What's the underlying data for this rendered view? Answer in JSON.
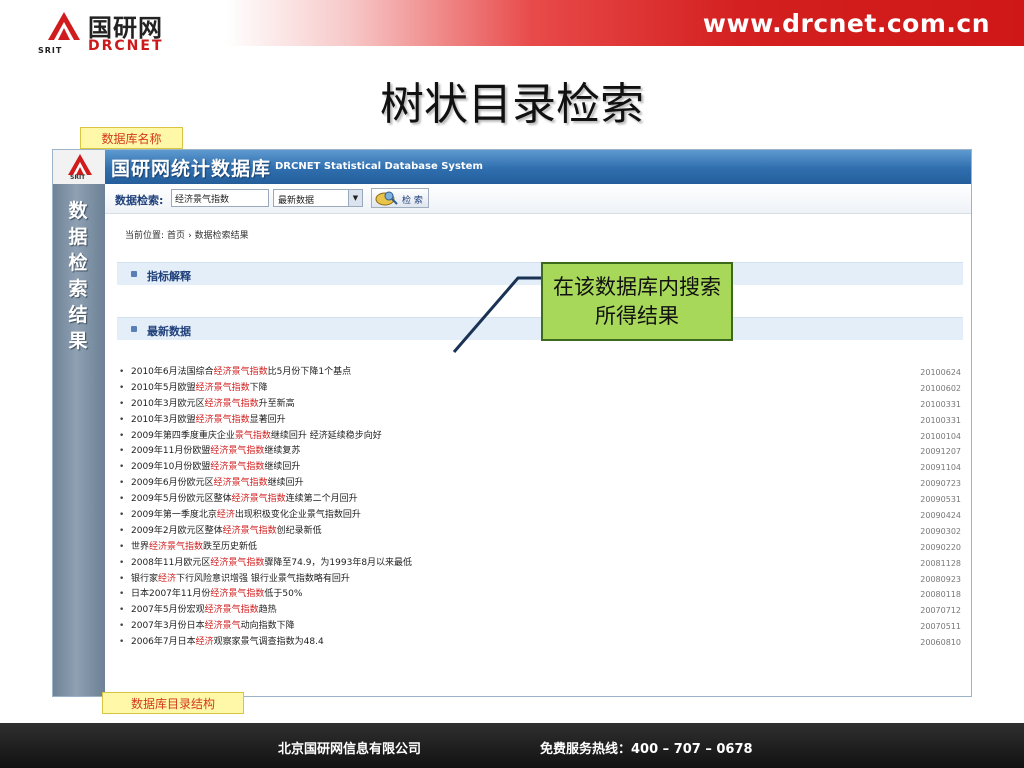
{
  "brand": {
    "logo_cn": "国研网",
    "logo_en": "DRCNET",
    "logo_srit": "SRIT",
    "site_url": "www.drcnet.com.cn"
  },
  "slide": {
    "title": "树状目录检索",
    "tag_top": "数据库名称",
    "tag_bottom": "数据库目录结构",
    "callout": "在该数据库内搜索所得结果"
  },
  "app": {
    "title": "国研网统计数据库",
    "subtitle": "DRCNET Statistical Database System",
    "srit": "SRIT",
    "side_tab": "数据检索结果",
    "search": {
      "label": "数据检索:",
      "value": "经济景气指数",
      "select_value": "最新数据",
      "button_label": "检 索"
    },
    "breadcrumb": {
      "prefix": "当前位置:",
      "home": "首页",
      "separator": "›",
      "current": "数据检索结果"
    },
    "sections": {
      "indicator": "指标解释",
      "latest": "最新数据"
    },
    "results": [
      {
        "pre": "2010年6月法国综合",
        "hl": "经济景气指数",
        "post": "比5月份下降1个基点",
        "date": "20100624"
      },
      {
        "pre": "2010年5月欧盟",
        "hl": "经济景气指数",
        "post": "下降",
        "date": "20100602"
      },
      {
        "pre": "2010年3月欧元区",
        "hl": "经济景气指数",
        "post": "升至新高",
        "date": "20100331"
      },
      {
        "pre": "2010年3月欧盟",
        "hl": "经济景气指数",
        "post": "显著回升",
        "date": "20100331"
      },
      {
        "pre": "2009年第四季度重庆企业",
        "hl": "景气指数",
        "post": "继续回升 经济延续稳步向好",
        "date": "20100104"
      },
      {
        "pre": "2009年11月份欧盟",
        "hl": "经济景气指数",
        "post": "继续复苏",
        "date": "20091207"
      },
      {
        "pre": "2009年10月份欧盟",
        "hl": "经济景气指数",
        "post": "继续回升",
        "date": "20091104"
      },
      {
        "pre": "2009年6月份欧元区",
        "hl": "经济景气指数",
        "post": "继续回升",
        "date": "20090723"
      },
      {
        "pre": "2009年5月份欧元区整体",
        "hl": "经济景气指数",
        "post": "连续第二个月回升",
        "date": "20090531"
      },
      {
        "pre": "2009年第一季度北京",
        "hl": "经济",
        "post": "出现积极变化企业景气指数回升",
        "date": "20090424"
      },
      {
        "pre": "2009年2月欧元区整体",
        "hl": "经济景气指数",
        "post": "创纪录新低",
        "date": "20090302"
      },
      {
        "pre": "世界",
        "hl": "经济景气指数",
        "post": "跌至历史新低",
        "date": "20090220"
      },
      {
        "pre": "2008年11月欧元区",
        "hl": "经济景气指数",
        "post": "骤降至74.9，为1993年8月以来最低",
        "date": "20081128"
      },
      {
        "pre": "银行家",
        "hl": "经济",
        "post": "下行风险意识增强 银行业景气指数略有回升",
        "date": "20080923"
      },
      {
        "pre": "日本2007年11月份",
        "hl": "经济景气指数",
        "post": "低于50%",
        "date": "20080118"
      },
      {
        "pre": "2007年5月份宏观",
        "hl": "经济景气指数",
        "post": "趋热",
        "date": "20070712"
      },
      {
        "pre": "2007年3月份日本",
        "hl": "经济景气",
        "post": "动向指数下降",
        "date": "20070511"
      },
      {
        "pre": "2006年7月日本",
        "hl": "经济",
        "post": "观察家景气调查指数为48.4",
        "date": "20060810"
      }
    ]
  },
  "footer": {
    "company": "北京国研网信息有限公司",
    "hotline": "免费服务热线：400 – 707 – 0678"
  },
  "colors": {
    "accent_red": "#cf1717",
    "app_blue": "#2f6eae",
    "callout_green": "#a8d85a",
    "highlight": "#d21e1e"
  }
}
